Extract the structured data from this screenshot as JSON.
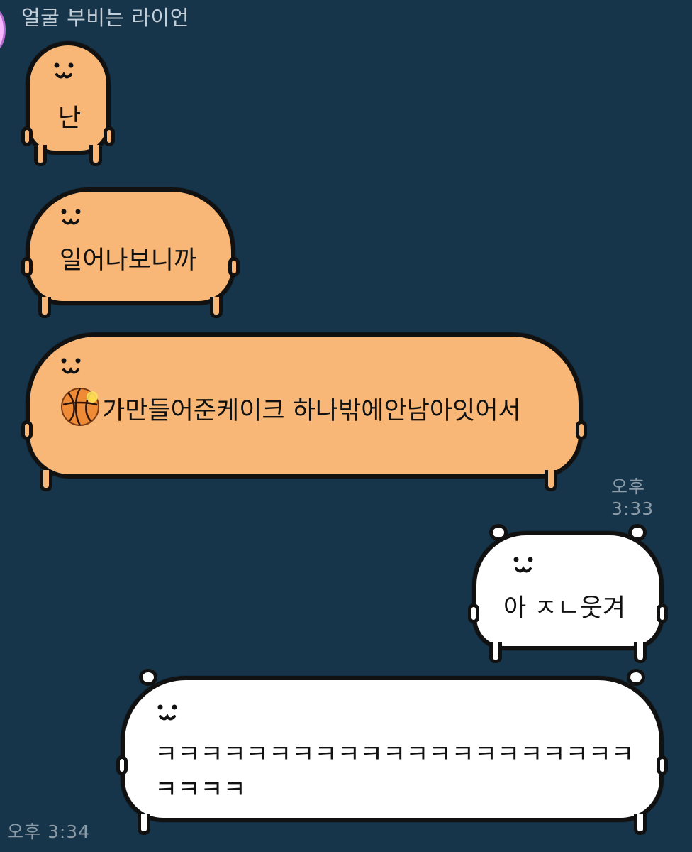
{
  "chat": {
    "sender_name": "얼굴 부비는 라이언",
    "messages": [
      {
        "text": "난"
      },
      {
        "text": "일어나보니까"
      },
      {
        "text": "가만들어준케이크 하나밖에안남아잇어서"
      },
      {
        "text": "아 ㅈㄴ웃겨"
      },
      {
        "text": "ㅋㅋㅋㅋㅋㅋㅋㅋㅋㅋㅋㅋㅋㅋㅋㅋㅋㅋㅋㅋㅋㅋㅋㅋㅋ"
      }
    ],
    "timestamps": {
      "received": "오후 3:33",
      "sent": "오후 3:34"
    }
  },
  "colors": {
    "background": "#16354a",
    "received_bubble": "#f8b777",
    "sent_bubble": "#ffffff",
    "outline": "#111111",
    "avatar": "#f7b7ff",
    "timestamp_text": "#8d9ba7"
  },
  "icons": {
    "message_3_emoji": "basketball-icon"
  }
}
